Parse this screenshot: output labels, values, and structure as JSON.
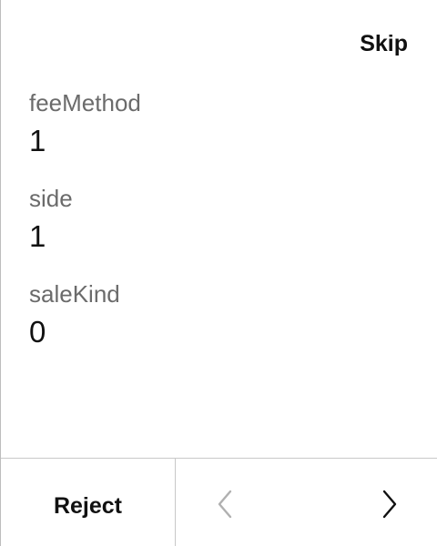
{
  "header": {
    "skip_label": "Skip"
  },
  "fields": [
    {
      "label": "feeMethod",
      "value": "1"
    },
    {
      "label": "side",
      "value": "1"
    },
    {
      "label": "saleKind",
      "value": "0"
    }
  ],
  "footer": {
    "reject_label": "Reject",
    "prev_icon": "chevron-left-icon",
    "next_icon": "chevron-right-icon",
    "prev_enabled": false,
    "next_enabled": true
  },
  "colors": {
    "text": "#111111",
    "label": "#6b6b6b",
    "divider": "#c8c8c8",
    "disabled": "#b0b0b0"
  }
}
